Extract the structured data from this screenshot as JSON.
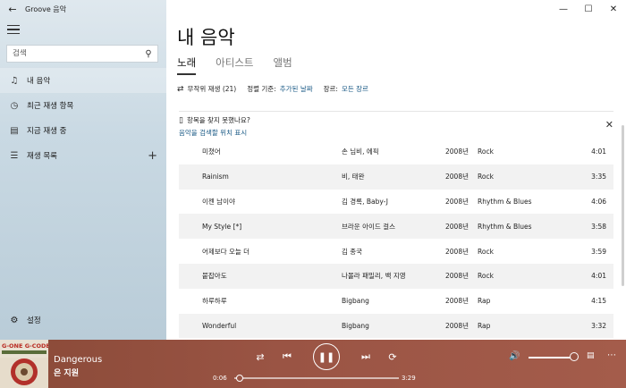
{
  "app": {
    "title": "Groove 음악"
  },
  "sidebar": {
    "search_placeholder": "검색",
    "items": [
      {
        "label": "내 음악",
        "icon": "music-note-icon"
      },
      {
        "label": "최근 재생 항목",
        "icon": "clock-icon"
      },
      {
        "label": "지금 재생 중",
        "icon": "bars-icon"
      },
      {
        "label": "재생 목록",
        "icon": "playlist-icon"
      }
    ],
    "settings_label": "설정"
  },
  "main": {
    "title": "내 음악",
    "tabs": [
      {
        "label": "노래",
        "active": true
      },
      {
        "label": "아티스트",
        "active": false
      },
      {
        "label": "앨범",
        "active": false
      }
    ],
    "toolbar": {
      "shuffle": "무작위 재생 (21)",
      "sort_label": "정렬 기준:",
      "sort_value": "추가된 날짜",
      "genre_label": "장르:",
      "genre_value": "모든 장르"
    },
    "notice": {
      "title": "항목을 찾지 못했나요?",
      "link": "음악을 검색할 위치 표시"
    },
    "songs": [
      {
        "title": "미쳤어",
        "artist": "손 님비, 에픽",
        "year": "2008년",
        "genre": "Rock",
        "duration": "4:01"
      },
      {
        "title": "Rainism",
        "artist": "비, 태완",
        "year": "2008년",
        "genre": "Rock",
        "duration": "3:35"
      },
      {
        "title": "이젠 남이야",
        "artist": "김 경록, Baby-J",
        "year": "2008년",
        "genre": "Rhythm & Blues",
        "duration": "4:06"
      },
      {
        "title": "My Style [*]",
        "artist": "브라운 아이드 걸스",
        "year": "2008년",
        "genre": "Rhythm & Blues",
        "duration": "3:58"
      },
      {
        "title": "어제보다 오늘 더",
        "artist": "김 종국",
        "year": "2008년",
        "genre": "Rock",
        "duration": "3:59"
      },
      {
        "title": "붙잡아도",
        "artist": "나몰라 패밀리, 백 지영",
        "year": "2008년",
        "genre": "Rock",
        "duration": "4:01"
      },
      {
        "title": "하루하루",
        "artist": "Bigbang",
        "year": "2008년",
        "genre": "Rap",
        "duration": "4:15"
      },
      {
        "title": "Wonderful",
        "artist": "Bigbang",
        "year": "2008년",
        "genre": "Rap",
        "duration": "3:32"
      }
    ]
  },
  "player": {
    "title": "Dangerous",
    "artist": "은 지원",
    "time_current": "0:06",
    "time_total": "3:29",
    "progress": 0.03,
    "volume": 1.0,
    "accent_color": "#9a5444",
    "album_art_text": "G-ONE G-CODE"
  }
}
